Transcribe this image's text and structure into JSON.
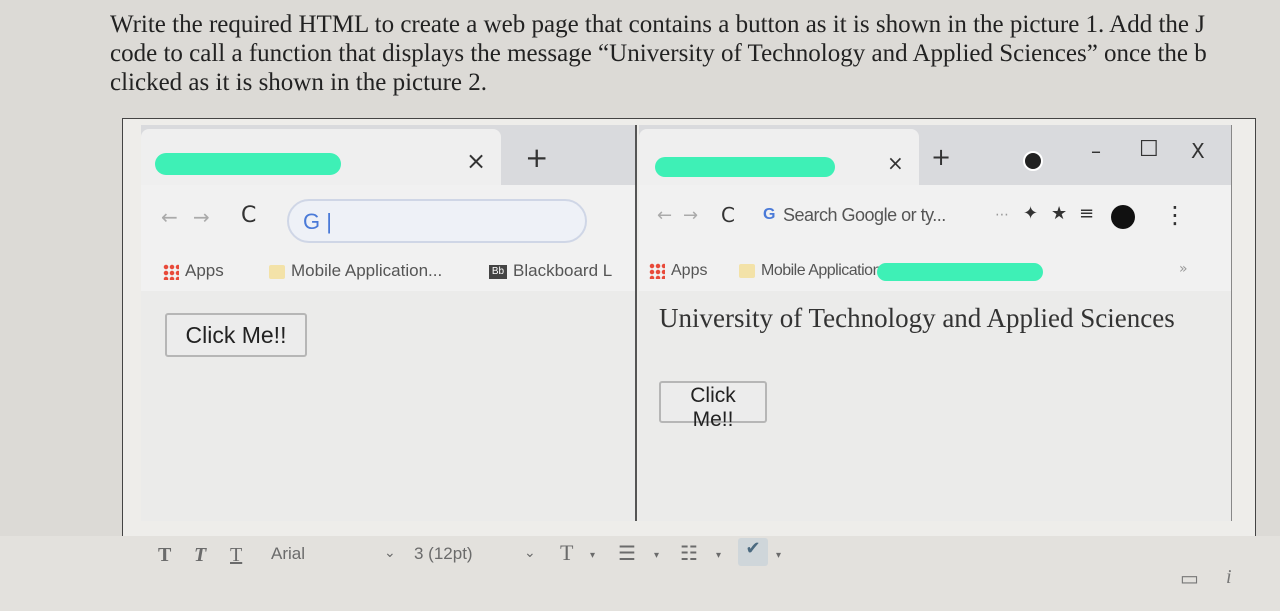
{
  "question": {
    "line1": "Write the required HTML to create a web page that contains a button as it is shown in the picture 1. Add the J",
    "line2": "code to call a function that displays the message “University of Technology and Applied Sciences” once the b",
    "line3": "clicked as it is shown in the picture 2."
  },
  "left_browser": {
    "tab_close": "×",
    "new_tab": "+",
    "back": "←",
    "forward": "→",
    "reload": "C",
    "omnibox_text": "G |",
    "bookmarks": [
      "Apps",
      "Mobile Application...",
      "Blackboard L"
    ],
    "button_label": "Click Me!!"
  },
  "right_browser": {
    "tab_close": "×",
    "new_tab": "+",
    "minimize": "–",
    "maximize": "☐",
    "close": "X",
    "back": "←",
    "forward": "→",
    "reload": "C",
    "omnibox_placeholder": "Search Google or ty...",
    "bookmarks": [
      "Apps",
      "Mobile Application..."
    ],
    "bookmark_overflow": "»",
    "menu": "⋮",
    "message": "University of Technology and Applied Sciences",
    "button_label": "Click Me!!"
  },
  "editor_toolbar": {
    "format_buttons": [
      "T",
      "T",
      "T"
    ],
    "font_family": "Arial",
    "font_size": "3 (12pt)",
    "text_color": "T",
    "bullets_icon": "bullet-list-icon",
    "numbering_icon": "numbered-list-icon",
    "spellcheck_icon": "spellcheck-icon"
  },
  "colors": {
    "redaction": "#3ef0b6",
    "bookmark_folder": "#f3e2a8"
  }
}
